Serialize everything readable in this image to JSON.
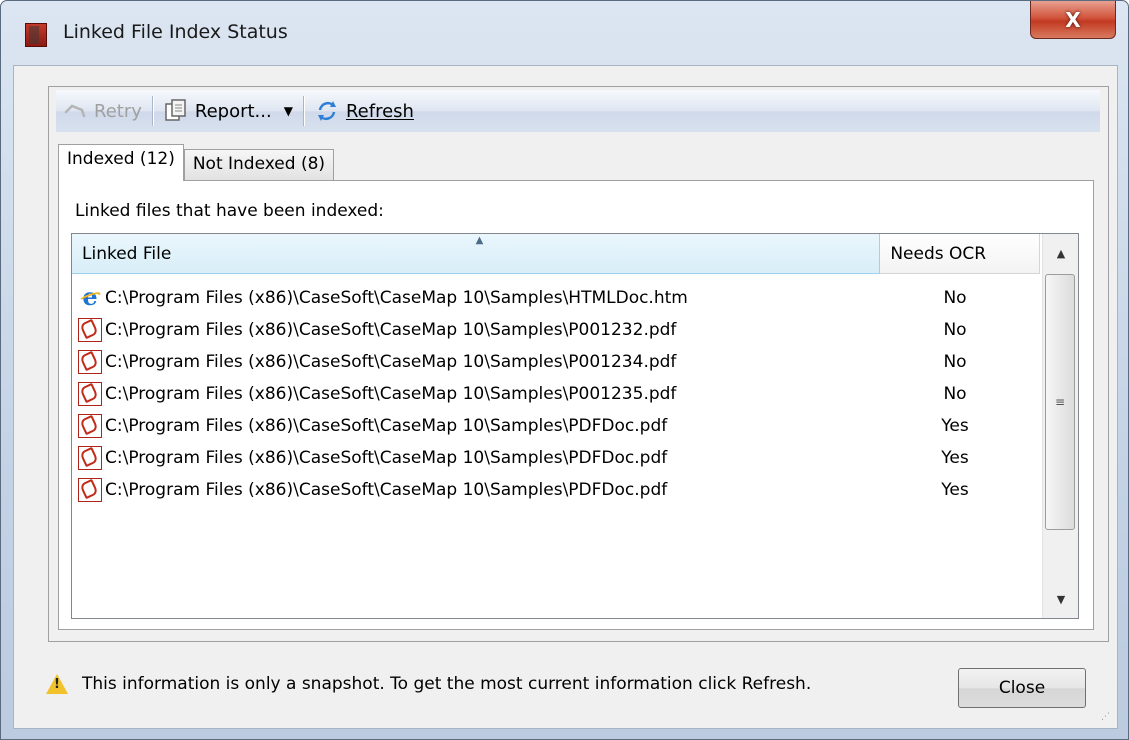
{
  "window": {
    "title": "Linked File Index Status",
    "close_glyph": "X"
  },
  "toolbar": {
    "retry_label": "Retry",
    "report_label": "Report...",
    "report_dropdown_glyph": "▼",
    "refresh_label": "Refresh"
  },
  "tabs": [
    {
      "label": "Indexed (12)",
      "active": true
    },
    {
      "label": "Not Indexed (8)",
      "active": false
    }
  ],
  "panel": {
    "label": "Linked files that have been indexed:"
  },
  "list": {
    "columns": [
      "Linked File",
      "Needs OCR"
    ],
    "sorted_column": "Linked File",
    "rows": [
      {
        "icon": "ie-html-icon",
        "file": "C:\\Program Files (x86)\\CaseSoft\\CaseMap 10\\Samples\\HTMLDoc.htm",
        "needs_ocr": "No"
      },
      {
        "icon": "pdf-icon",
        "file": "C:\\Program Files (x86)\\CaseSoft\\CaseMap 10\\Samples\\P001232.pdf",
        "needs_ocr": "No"
      },
      {
        "icon": "pdf-icon",
        "file": "C:\\Program Files (x86)\\CaseSoft\\CaseMap 10\\Samples\\P001234.pdf",
        "needs_ocr": "No"
      },
      {
        "icon": "pdf-icon",
        "file": "C:\\Program Files (x86)\\CaseSoft\\CaseMap 10\\Samples\\P001235.pdf",
        "needs_ocr": "No"
      },
      {
        "icon": "pdf-icon",
        "file": "C:\\Program Files (x86)\\CaseSoft\\CaseMap 10\\Samples\\PDFDoc.pdf",
        "needs_ocr": "Yes"
      },
      {
        "icon": "pdf-icon",
        "file": "C:\\Program Files (x86)\\CaseSoft\\CaseMap 10\\Samples\\PDFDoc.pdf",
        "needs_ocr": "Yes"
      },
      {
        "icon": "pdf-icon",
        "file": "C:\\Program Files (x86)\\CaseSoft\\CaseMap 10\\Samples\\PDFDoc.pdf",
        "needs_ocr": "Yes"
      }
    ]
  },
  "footer": {
    "message": "This information is only a snapshot.  To get the most current information click Refresh.",
    "close_label": "Close"
  },
  "colors": {
    "accent": "#c23a22",
    "toolbar": "#dfe6f1",
    "warning": "#f2c22c"
  }
}
